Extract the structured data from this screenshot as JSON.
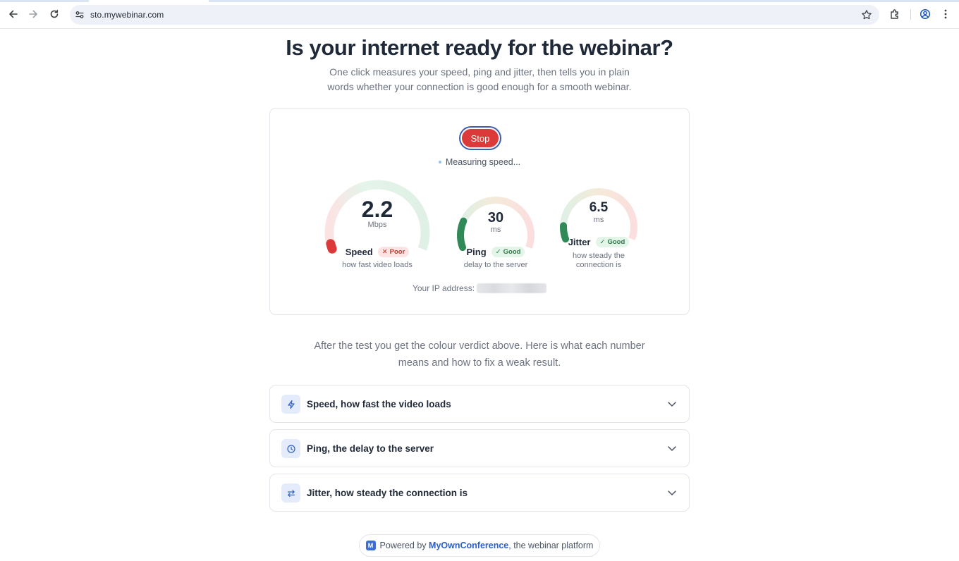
{
  "browser": {
    "url": "sto.mywebinar.com"
  },
  "page": {
    "title": "Is your internet ready for the webinar?",
    "subtitle": "One click measures your speed, ping and jitter, then tells you in plain words whether your connection is good enough for a smooth webinar."
  },
  "test": {
    "stop_label": "Stop",
    "status": "Measuring speed...",
    "ip_label": "Your IP address:"
  },
  "metrics": [
    {
      "value": "2.2",
      "unit": "Mbps",
      "label": "Speed",
      "badge": "Poor",
      "badge_icon": "x-icon",
      "desc": "how fast video loads",
      "level": 0.02,
      "color": "#dc3a3a"
    },
    {
      "value": "30",
      "unit": "ms",
      "label": "Ping",
      "badge": "Good",
      "badge_icon": "check-icon",
      "desc": "delay to the server",
      "level": 0.2,
      "color": "#2f8a57"
    },
    {
      "value": "6.5",
      "unit": "ms",
      "label": "Jitter",
      "badge": "Good",
      "badge_icon": "check-icon",
      "desc": "how steady the connection is",
      "level": 0.1,
      "color": "#2f8a57"
    }
  ],
  "explain": "After the test you get the colour verdict above. Here is what each number means and how to fix a weak result.",
  "accordion": [
    {
      "title": "Speed, how fast the video loads",
      "icon": "lightning-icon"
    },
    {
      "title": "Ping, the delay to the server",
      "icon": "clock-icon"
    },
    {
      "title": "Jitter, how steady the connection is",
      "icon": "swap-arrows-icon"
    }
  ],
  "footer": {
    "prefix": "Powered by",
    "brand": "MyOwnConference",
    "suffix": ", the webinar platform",
    "logo_letter": "M"
  },
  "colors": {
    "stop": "#dc3a3a",
    "good": "#2f8a57",
    "poor": "#dc3a3a",
    "accent": "#2d5fc4"
  }
}
